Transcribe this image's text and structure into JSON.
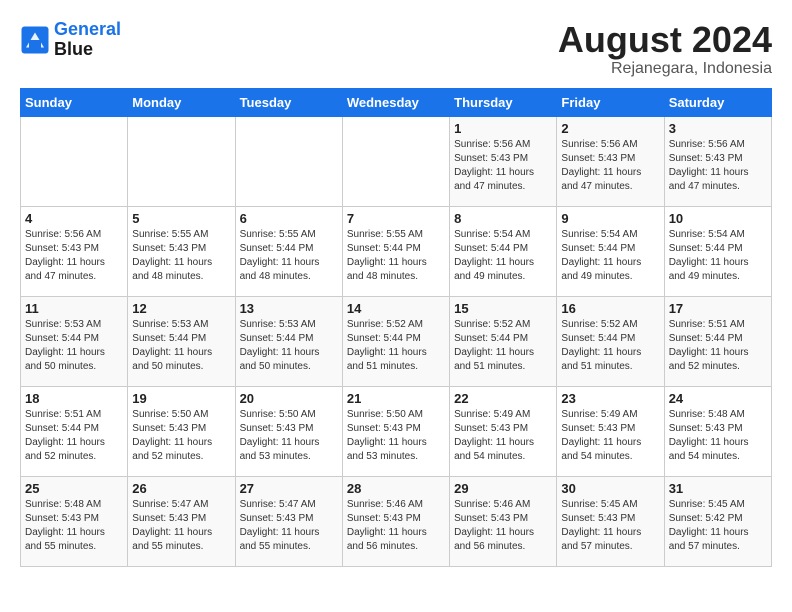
{
  "header": {
    "logo_line1": "General",
    "logo_line2": "Blue",
    "month_title": "August 2024",
    "subtitle": "Rejanegara, Indonesia"
  },
  "weekdays": [
    "Sunday",
    "Monday",
    "Tuesday",
    "Wednesday",
    "Thursday",
    "Friday",
    "Saturday"
  ],
  "weeks": [
    [
      {
        "day": "",
        "info": ""
      },
      {
        "day": "",
        "info": ""
      },
      {
        "day": "",
        "info": ""
      },
      {
        "day": "",
        "info": ""
      },
      {
        "day": "1",
        "info": "Sunrise: 5:56 AM\nSunset: 5:43 PM\nDaylight: 11 hours\nand 47 minutes."
      },
      {
        "day": "2",
        "info": "Sunrise: 5:56 AM\nSunset: 5:43 PM\nDaylight: 11 hours\nand 47 minutes."
      },
      {
        "day": "3",
        "info": "Sunrise: 5:56 AM\nSunset: 5:43 PM\nDaylight: 11 hours\nand 47 minutes."
      }
    ],
    [
      {
        "day": "4",
        "info": "Sunrise: 5:56 AM\nSunset: 5:43 PM\nDaylight: 11 hours\nand 47 minutes."
      },
      {
        "day": "5",
        "info": "Sunrise: 5:55 AM\nSunset: 5:43 PM\nDaylight: 11 hours\nand 48 minutes."
      },
      {
        "day": "6",
        "info": "Sunrise: 5:55 AM\nSunset: 5:44 PM\nDaylight: 11 hours\nand 48 minutes."
      },
      {
        "day": "7",
        "info": "Sunrise: 5:55 AM\nSunset: 5:44 PM\nDaylight: 11 hours\nand 48 minutes."
      },
      {
        "day": "8",
        "info": "Sunrise: 5:54 AM\nSunset: 5:44 PM\nDaylight: 11 hours\nand 49 minutes."
      },
      {
        "day": "9",
        "info": "Sunrise: 5:54 AM\nSunset: 5:44 PM\nDaylight: 11 hours\nand 49 minutes."
      },
      {
        "day": "10",
        "info": "Sunrise: 5:54 AM\nSunset: 5:44 PM\nDaylight: 11 hours\nand 49 minutes."
      }
    ],
    [
      {
        "day": "11",
        "info": "Sunrise: 5:53 AM\nSunset: 5:44 PM\nDaylight: 11 hours\nand 50 minutes."
      },
      {
        "day": "12",
        "info": "Sunrise: 5:53 AM\nSunset: 5:44 PM\nDaylight: 11 hours\nand 50 minutes."
      },
      {
        "day": "13",
        "info": "Sunrise: 5:53 AM\nSunset: 5:44 PM\nDaylight: 11 hours\nand 50 minutes."
      },
      {
        "day": "14",
        "info": "Sunrise: 5:52 AM\nSunset: 5:44 PM\nDaylight: 11 hours\nand 51 minutes."
      },
      {
        "day": "15",
        "info": "Sunrise: 5:52 AM\nSunset: 5:44 PM\nDaylight: 11 hours\nand 51 minutes."
      },
      {
        "day": "16",
        "info": "Sunrise: 5:52 AM\nSunset: 5:44 PM\nDaylight: 11 hours\nand 51 minutes."
      },
      {
        "day": "17",
        "info": "Sunrise: 5:51 AM\nSunset: 5:44 PM\nDaylight: 11 hours\nand 52 minutes."
      }
    ],
    [
      {
        "day": "18",
        "info": "Sunrise: 5:51 AM\nSunset: 5:44 PM\nDaylight: 11 hours\nand 52 minutes."
      },
      {
        "day": "19",
        "info": "Sunrise: 5:50 AM\nSunset: 5:43 PM\nDaylight: 11 hours\nand 52 minutes."
      },
      {
        "day": "20",
        "info": "Sunrise: 5:50 AM\nSunset: 5:43 PM\nDaylight: 11 hours\nand 53 minutes."
      },
      {
        "day": "21",
        "info": "Sunrise: 5:50 AM\nSunset: 5:43 PM\nDaylight: 11 hours\nand 53 minutes."
      },
      {
        "day": "22",
        "info": "Sunrise: 5:49 AM\nSunset: 5:43 PM\nDaylight: 11 hours\nand 54 minutes."
      },
      {
        "day": "23",
        "info": "Sunrise: 5:49 AM\nSunset: 5:43 PM\nDaylight: 11 hours\nand 54 minutes."
      },
      {
        "day": "24",
        "info": "Sunrise: 5:48 AM\nSunset: 5:43 PM\nDaylight: 11 hours\nand 54 minutes."
      }
    ],
    [
      {
        "day": "25",
        "info": "Sunrise: 5:48 AM\nSunset: 5:43 PM\nDaylight: 11 hours\nand 55 minutes."
      },
      {
        "day": "26",
        "info": "Sunrise: 5:47 AM\nSunset: 5:43 PM\nDaylight: 11 hours\nand 55 minutes."
      },
      {
        "day": "27",
        "info": "Sunrise: 5:47 AM\nSunset: 5:43 PM\nDaylight: 11 hours\nand 55 minutes."
      },
      {
        "day": "28",
        "info": "Sunrise: 5:46 AM\nSunset: 5:43 PM\nDaylight: 11 hours\nand 56 minutes."
      },
      {
        "day": "29",
        "info": "Sunrise: 5:46 AM\nSunset: 5:43 PM\nDaylight: 11 hours\nand 56 minutes."
      },
      {
        "day": "30",
        "info": "Sunrise: 5:45 AM\nSunset: 5:43 PM\nDaylight: 11 hours\nand 57 minutes."
      },
      {
        "day": "31",
        "info": "Sunrise: 5:45 AM\nSunset: 5:42 PM\nDaylight: 11 hours\nand 57 minutes."
      }
    ]
  ]
}
